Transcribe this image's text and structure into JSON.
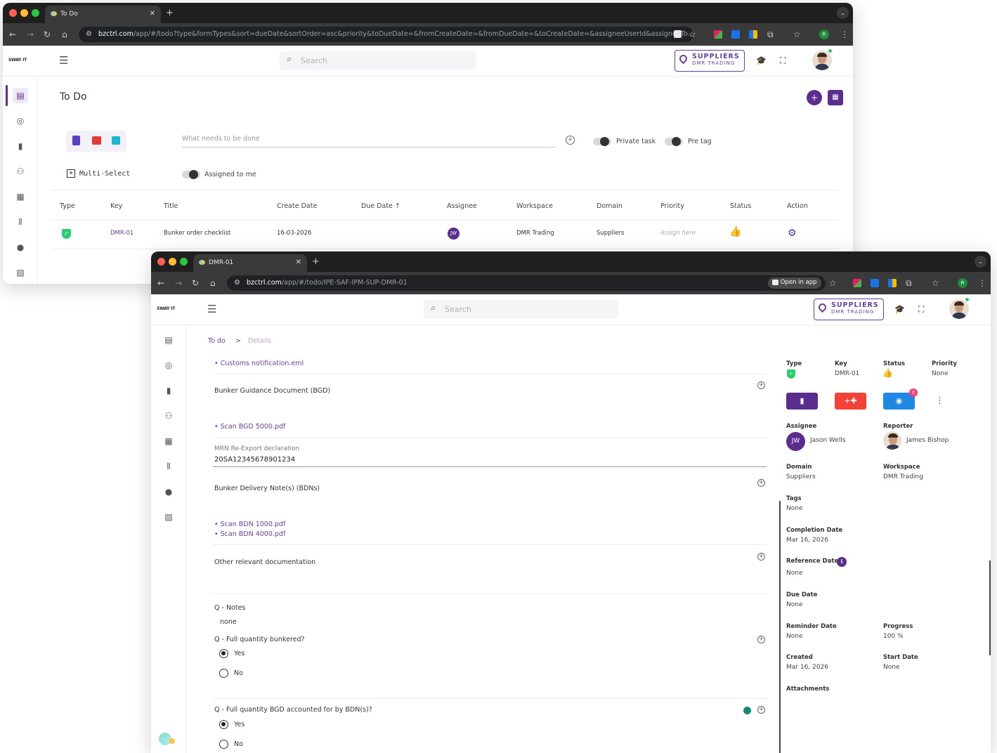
{
  "window1": {
    "tab_title": "To Do",
    "url_host": "bzctrl.com",
    "url_path": "/app/#/todo?type&formTypes&sort=dueDate&sortOrder=asc&priority&toDueDate=&fromCreateDate=&fromDueDate=&toCreateDate=&assigneeUserId&assignedTo...",
    "search_placeholder": "Search",
    "location_badge": {
      "title": "SUPPLIERS",
      "subtitle": "DMR TRADING"
    },
    "page_title": "To Do",
    "todo_placeholder": "What needs to be done",
    "private_task_label": "Private task",
    "pre_tag_label": "Pre tag",
    "multi_select_label": "Multi-Select",
    "assigned_to_me_label": "Assigned to me",
    "table": {
      "headers": [
        "Type",
        "Key",
        "Title",
        "Create Date",
        "Due Date",
        "Assignee",
        "Workspace",
        "Domain",
        "Priority",
        "Status",
        "Action"
      ],
      "rows": [
        {
          "key": "DMR-01",
          "title": "Bunker order checklist",
          "create_date": "16-03-2026",
          "assignee": "JW",
          "workspace": "DMR Trading",
          "domain": "Suppliers",
          "priority": "Assign here"
        }
      ]
    }
  },
  "window2": {
    "tab_title": "DMR-01",
    "url_host": "bzctrl.com",
    "url_path": "/app/#/todo/IPE-SAF-IPM-SUP-DMR-01",
    "open_in_app": "Open in app",
    "search_placeholder": "Search",
    "location_badge": {
      "title": "SUPPLIERS",
      "subtitle": "DMR TRADING"
    },
    "breadcrumb": {
      "root": "To do",
      "separator": ">",
      "current": "Details"
    },
    "content": {
      "link_customs": "• Customs notification.eml",
      "bgd_title": "Bunker Guidance Document (BGD)",
      "link_bgd": "• Scan BGD 5000.pdf",
      "mrn_label": "MRN Re-Export declaration",
      "mrn_value": "20SA12345678901234",
      "bdn_title": "Bunker Delivery Note(s) (BDNs)",
      "link_bdn1": "• Scan BDN 1000.pdf",
      "link_bdn2": "• Scan BDN 4000.pdf",
      "other_title": "Other relevant documentation",
      "notes_label": "Q - Notes",
      "notes_value": "none",
      "q1": "Q - Full quantity bunkered?",
      "q1_yes": "Yes",
      "q1_no": "No",
      "q2": "Q - Full quantity BGD accounted for by BDN(s)?",
      "q2_yes": "Yes",
      "q2_no": "No"
    },
    "panel": {
      "type_label": "Type",
      "key_label": "Key",
      "key_value": "DMR-01",
      "status_label": "Status",
      "priority_label": "Priority",
      "priority_value": "None",
      "watch_count": "0",
      "assignee_label": "Assignee",
      "assignee_initials": "JW",
      "assignee_name": "Jason Wells",
      "reporter_label": "Reporter",
      "reporter_name": "James Bishop",
      "domain_label": "Domain",
      "domain_value": "Suppliers",
      "workspace_label": "Workspace",
      "workspace_value": "DMR Trading",
      "tags_label": "Tags",
      "tags_value": "None",
      "completion_label": "Completion Date",
      "completion_value": "Mar 16, 2026",
      "reference_label": "Reference Date",
      "reference_value": "None",
      "due_label": "Due Date",
      "due_value": "None",
      "reminder_label": "Reminder Date",
      "reminder_value": "None",
      "progress_label": "Progress",
      "progress_value": "100 %",
      "created_label": "Created",
      "created_value": "Mar 16, 2026",
      "start_label": "Start Date",
      "start_value": "None",
      "attachments_label": "Attachments"
    }
  },
  "colors": {
    "brand": "#5b2d8e",
    "accent_red": "#f44336",
    "accent_blue": "#1e88e5",
    "success": "#2ecc71"
  },
  "logo_text": "SWAY IT"
}
